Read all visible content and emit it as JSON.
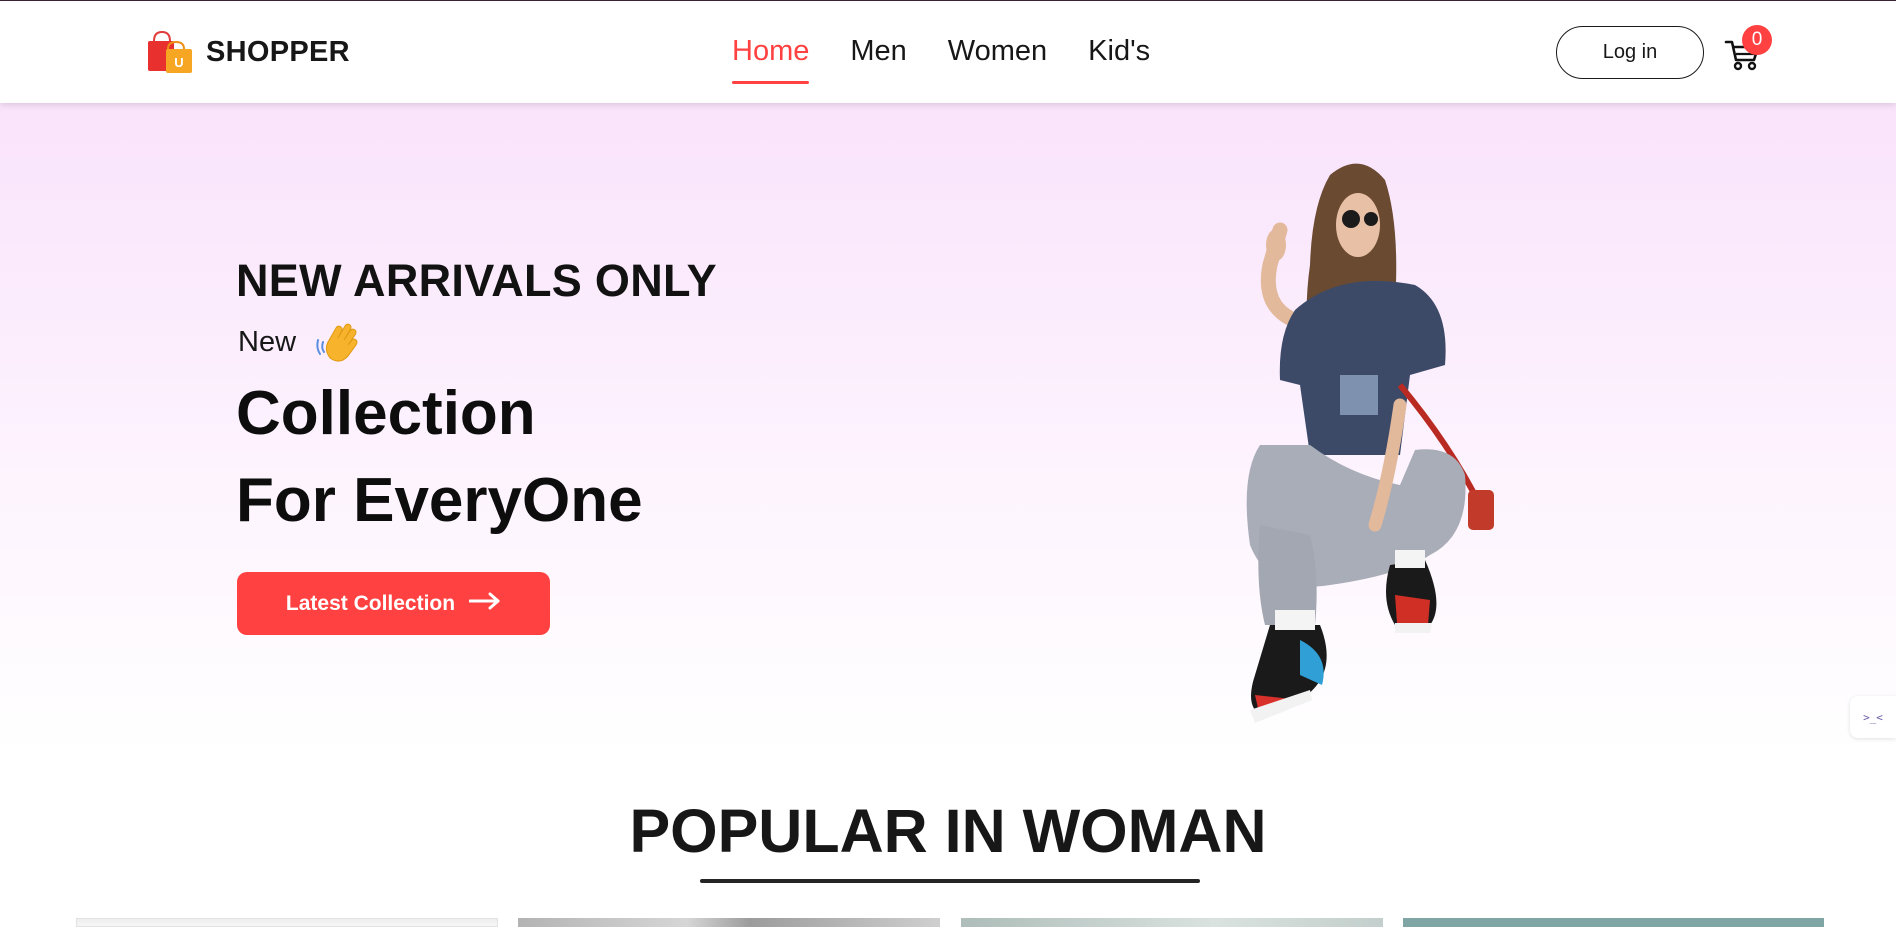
{
  "brand": {
    "name": "SHOPPER"
  },
  "nav": {
    "items": [
      {
        "label": "Home",
        "active": true
      },
      {
        "label": "Men",
        "active": false
      },
      {
        "label": "Women",
        "active": false
      },
      {
        "label": "Kid's",
        "active": false
      }
    ],
    "login_label": "Log in",
    "cart_count": "0"
  },
  "hero": {
    "eyebrow": "NEW ARRIVALS ONLY",
    "new_label": "New",
    "title_line1": "Collection",
    "title_line2": "For EveryOne",
    "cta_label": "Latest Collection"
  },
  "popular": {
    "title": "POPULAR IN WOMAN"
  },
  "icons": {
    "logo": "shopping-bag-icon",
    "cart": "cart-icon",
    "wave": "waving-hand-icon",
    "cta_arrow": "arrow-right-icon",
    "side_widget": "extension-widget-icon"
  },
  "colors": {
    "accent": "#ff4141",
    "hero_gradient_top": "#f9e3fb",
    "text": "#171717"
  },
  "side_widget_text": ">_<"
}
